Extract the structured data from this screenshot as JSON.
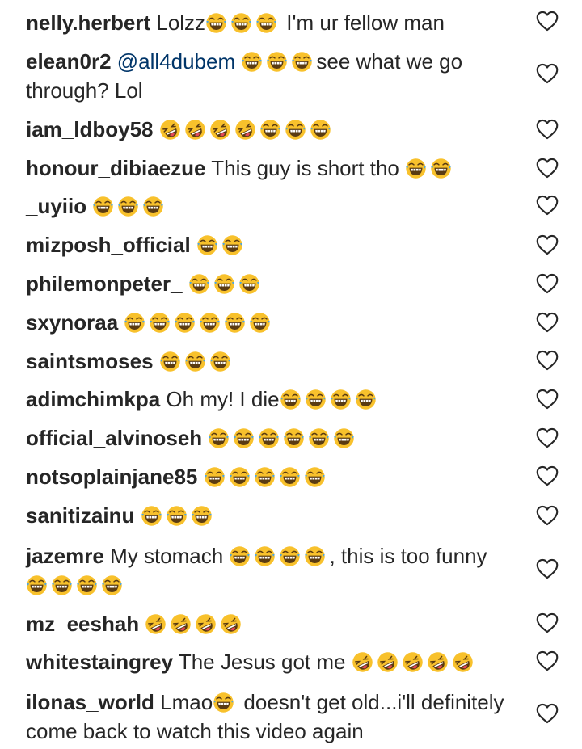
{
  "comments": [
    {
      "username": "nelly.herbert",
      "parts": [
        "Lolzz",
        {
          "emoji": "joy",
          "count": 3
        },
        " I'm ur fellow man"
      ]
    },
    {
      "username": "elean0r2",
      "parts": [
        {
          "mention": "@all4dubem"
        },
        " ",
        {
          "emoji": "joy",
          "count": 3
        },
        "see what we go through? Lol"
      ]
    },
    {
      "username": "iam_ldboy58",
      "parts": [
        {
          "emoji": "rofl",
          "count": 4
        },
        {
          "emoji": "joy",
          "count": 3
        }
      ]
    },
    {
      "username": "honour_dibiaezue",
      "parts": [
        "This guy is short tho ",
        {
          "emoji": "joy",
          "count": 2
        }
      ]
    },
    {
      "username": "_uyiio",
      "parts": [
        {
          "emoji": "joy",
          "count": 3
        }
      ]
    },
    {
      "username": "mizposh_official",
      "parts": [
        {
          "emoji": "joy",
          "count": 2
        }
      ]
    },
    {
      "username": "philemonpeter_",
      "parts": [
        {
          "emoji": "joy",
          "count": 3
        }
      ]
    },
    {
      "username": "sxynoraa",
      "parts": [
        {
          "emoji": "joy",
          "count": 6
        }
      ]
    },
    {
      "username": "saintsmoses",
      "parts": [
        {
          "emoji": "joy",
          "count": 3
        }
      ]
    },
    {
      "username": "adimchimkpa",
      "parts": [
        "Oh my! I die",
        {
          "emoji": "joy",
          "count": 4
        }
      ]
    },
    {
      "username": "official_alvinoseh",
      "parts": [
        {
          "emoji": "joy",
          "count": 6
        }
      ]
    },
    {
      "username": "notsoplainjane85",
      "parts": [
        {
          "emoji": "joy",
          "count": 5
        }
      ]
    },
    {
      "username": "sanitizainu",
      "parts": [
        {
          "emoji": "joy",
          "count": 3
        }
      ]
    },
    {
      "username": "jazemre",
      "parts": [
        "My stomach ",
        {
          "emoji": "joy",
          "count": 4
        },
        ", this is too funny ",
        {
          "emoji": "joy",
          "count": 4
        }
      ]
    },
    {
      "username": "mz_eeshah",
      "parts": [
        {
          "emoji": "rofl",
          "count": 4
        }
      ]
    },
    {
      "username": "whitestaingrey",
      "parts": [
        "The Jesus got me ",
        {
          "emoji": "rofl",
          "count": 5
        }
      ]
    },
    {
      "username": "ilonas_world",
      "parts": [
        "Lmao",
        {
          "emoji": "joy",
          "count": 1
        },
        " doesn't get old...i'll definitely come back to watch this video again"
      ]
    }
  ],
  "icons": {
    "like": "heart-outline-icon",
    "joy": "face-with-tears-of-joy-icon",
    "rofl": "rolling-on-floor-laughing-icon"
  },
  "colors": {
    "text": "#262626",
    "mention": "#003569",
    "heart": "#262626",
    "emoji": "#f8c12c"
  }
}
